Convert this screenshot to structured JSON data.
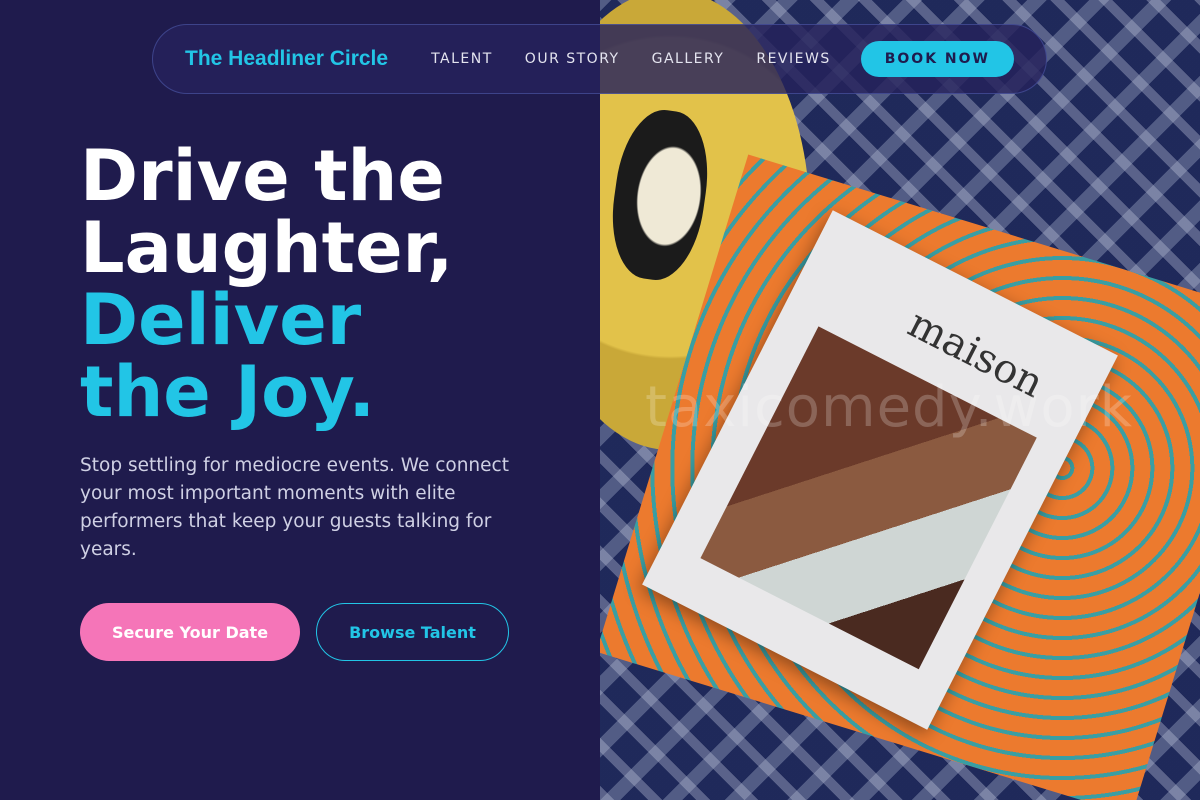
{
  "brand": {
    "name": "The Headliner Circle"
  },
  "nav": {
    "links": [
      "TALENT",
      "OUR STORY",
      "GALLERY",
      "REVIEWS"
    ],
    "cta": "BOOK NOW"
  },
  "hero": {
    "line1": "Drive the",
    "line2": "Laughter,",
    "accent1": "Deliver",
    "accent2": "the Joy.",
    "description": "Stop settling for mediocre events. We connect your most important moments with elite performers that keep your guests talking for years.",
    "primary_button": "Secure Your Date",
    "secondary_button": "Browse Talent"
  },
  "photo": {
    "book_title": "maison",
    "watermark": "taxicomedy.work"
  },
  "colors": {
    "background": "#1f1b4d",
    "accent": "#22c5e6",
    "pink": "#f575b8"
  }
}
